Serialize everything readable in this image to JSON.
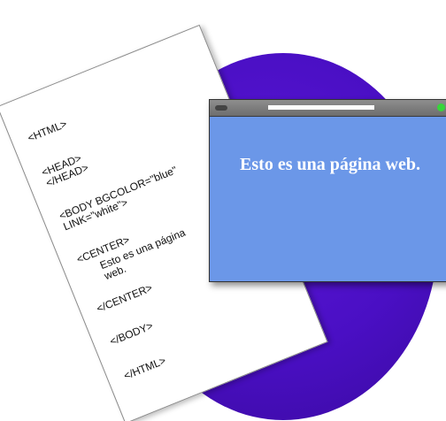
{
  "code_lines": {
    "html_open": "<HTML>",
    "head_open": "<HEAD>",
    "head_close": "</HEAD>",
    "body_open_1": "<BODY BGCOLOR=\"blue\"",
    "body_open_2": "LINK=\"white\">",
    "center_open": "<CENTER>",
    "content_1": "Esto es una página",
    "content_2": "web.",
    "center_close": "</CENTER>",
    "body_close": "</BODY>",
    "html_close": "</HTML>"
  },
  "browser": {
    "page_text": "Esto es una página web.",
    "background_color": "#6b97e8",
    "status_dot_color": "#37d63a"
  },
  "colors": {
    "circle": "#4a0fc4",
    "paper": "#ffffff"
  }
}
